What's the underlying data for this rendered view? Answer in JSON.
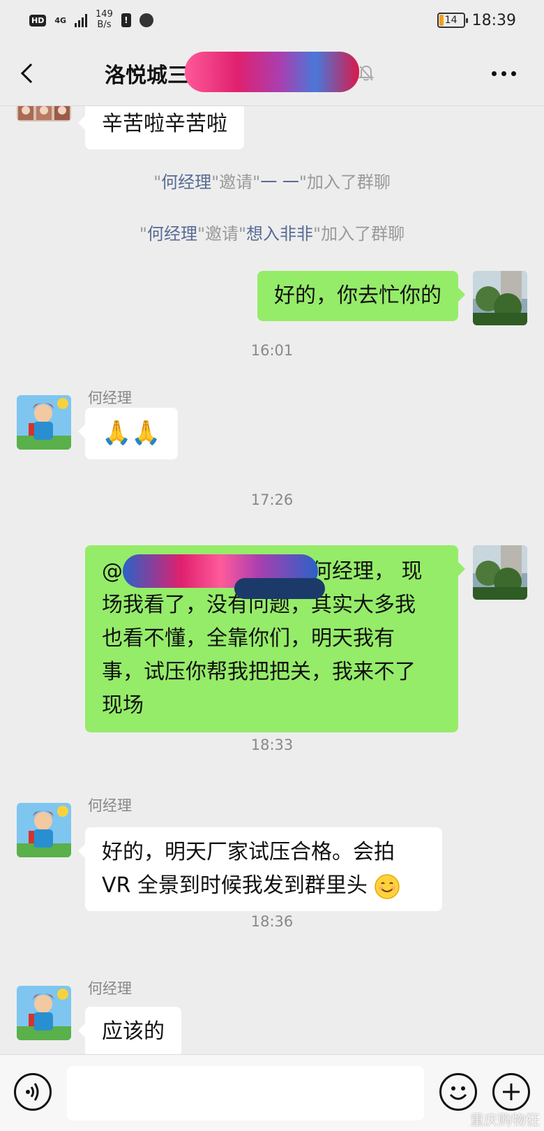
{
  "status_bar": {
    "hd": "HD",
    "network": "4G",
    "speed_value": "149",
    "speed_unit": "B/s",
    "alert": "!",
    "battery": "14",
    "time": "18:39"
  },
  "header": {
    "title": "洛悦城三期……装修群(8)",
    "muted": true
  },
  "messages": [
    {
      "type": "bubble",
      "side": "left",
      "avatar": "group-photo-avatar",
      "text": "辛苦啦辛苦啦"
    },
    {
      "type": "system",
      "quote_open": "\"",
      "inviter": "何经理",
      "mid": "\"邀请\"",
      "invitee": "一 一",
      "tail": "\"加入了群聊"
    },
    {
      "type": "system",
      "quote_open": "\"",
      "inviter": "何经理",
      "mid": "\"邀请\"",
      "invitee": "想入非非",
      "tail": "\"加入了群聊"
    },
    {
      "type": "bubble",
      "side": "right",
      "text": "好的，你去忙你的"
    },
    {
      "type": "time",
      "text": "16:01"
    },
    {
      "type": "bubble",
      "side": "left",
      "sender": "何经理",
      "text": "🙏🙏"
    },
    {
      "type": "time",
      "text": "17:26"
    },
    {
      "type": "bubble",
      "side": "right",
      "lines": [
        "@何经理………………何经理， 现",
        "场我看了，没有问题，其实大多我",
        "也看不懂，全靠你们，明天我有",
        "事，试压你帮我把把关，我来不了",
        "现场"
      ]
    },
    {
      "type": "time",
      "text": "18:33"
    },
    {
      "type": "bubble",
      "side": "left",
      "sender": "何经理",
      "lines": [
        "好的，明天厂家试压合格。会拍",
        "VR 全景到时候我发到群里头"
      ]
    },
    {
      "type": "time",
      "text": "18:36"
    },
    {
      "type": "bubble",
      "side": "left",
      "sender": "何经理",
      "text": "应该的"
    }
  ],
  "input": {
    "placeholder": ""
  },
  "watermark": "重庆购物狂",
  "colors": {
    "self_bubble": "#95ec69",
    "other_bubble": "#ffffff",
    "link": "#576b95",
    "background": "#ededed"
  },
  "icons": [
    "back-icon",
    "mute-icon",
    "more-icon",
    "voice-icon",
    "emoji-icon",
    "plus-icon"
  ]
}
